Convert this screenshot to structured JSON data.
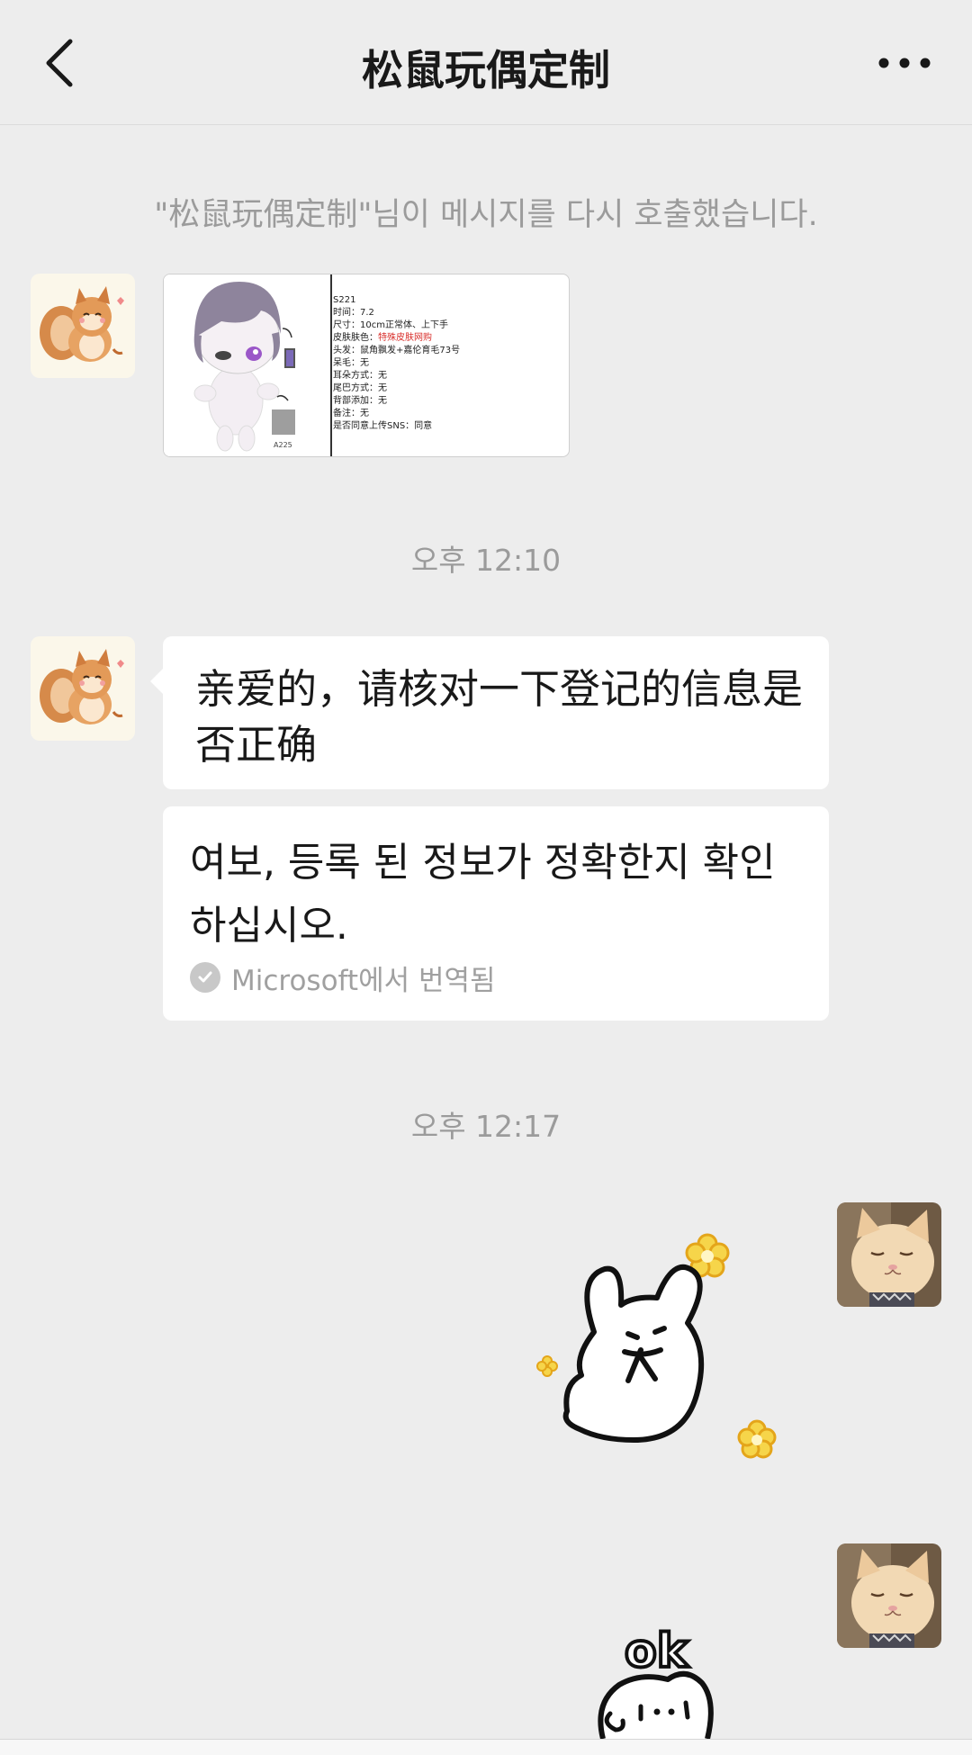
{
  "header": {
    "title": "松鼠玩偶定制",
    "back_icon": "chevron-left-icon",
    "more_icon": "more-dots-icon"
  },
  "messages": {
    "system_notice": "\"松鼠玩偶定制\"님이 메시지를 다시 호출했습니다.",
    "time_1": "오후 12:10",
    "time_2": "오후 12:17",
    "image_card": {
      "doll_code": "A225",
      "lines": [
        "S221",
        "时间：7.2",
        "尺寸：10cm正常体、上下手",
        "皮肤肤色：",
        "头发：",
        "呆毛：无",
        "耳朵方式：无",
        "尾巴方式：无",
        "背部添加：无",
        "备注：无",
        "是否同意上传SNS：同意"
      ],
      "skin_value": "特殊皮肤网购",
      "hair_value": "鼠角飘发+嘉伦育毛73号"
    },
    "received_text": "亲爱的，请核对一下登记的信息是否正确",
    "translation": {
      "text": "여보, 등록 된 정보가 정확한지 확인하십시오.",
      "label": "Microsoft에서 번역됨"
    },
    "sticker_2_text": "ok"
  }
}
